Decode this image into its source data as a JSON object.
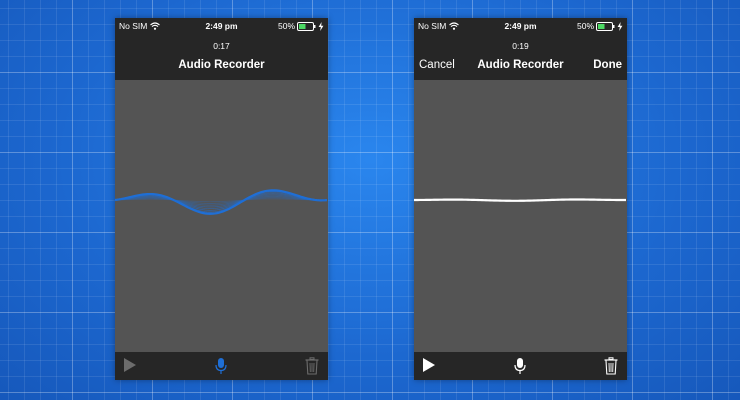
{
  "left_screen": {
    "status": {
      "carrier": "No SIM",
      "time": "2:49 pm",
      "battery": "50%",
      "battery_level": 0.5
    },
    "timer": "0:17",
    "title": "Audio Recorder",
    "state": "recording",
    "toolbar": {
      "play_icon": "play-icon",
      "mic_icon": "microphone-icon",
      "trash_icon": "trash-icon"
    },
    "colors": {
      "wave": "#1f6fd6",
      "mic_active": "#1f6fd6",
      "disabled_icon": "#6c6c6c"
    }
  },
  "right_screen": {
    "status": {
      "carrier": "No SIM",
      "time": "2:49 pm",
      "battery": "50%",
      "battery_level": 0.5
    },
    "timer": "0:19",
    "title": "Audio Recorder",
    "cancel_label": "Cancel",
    "done_label": "Done",
    "state": "stopped",
    "toolbar": {
      "play_icon": "play-icon",
      "mic_icon": "microphone-icon",
      "trash_icon": "trash-icon"
    },
    "colors": {
      "wave": "#ffffff",
      "icon": "#ffffff"
    }
  },
  "colors": {
    "background": "#1f6fd6",
    "bars": "#262626",
    "screen": "#545454",
    "battery_fill": "#4cd964"
  }
}
